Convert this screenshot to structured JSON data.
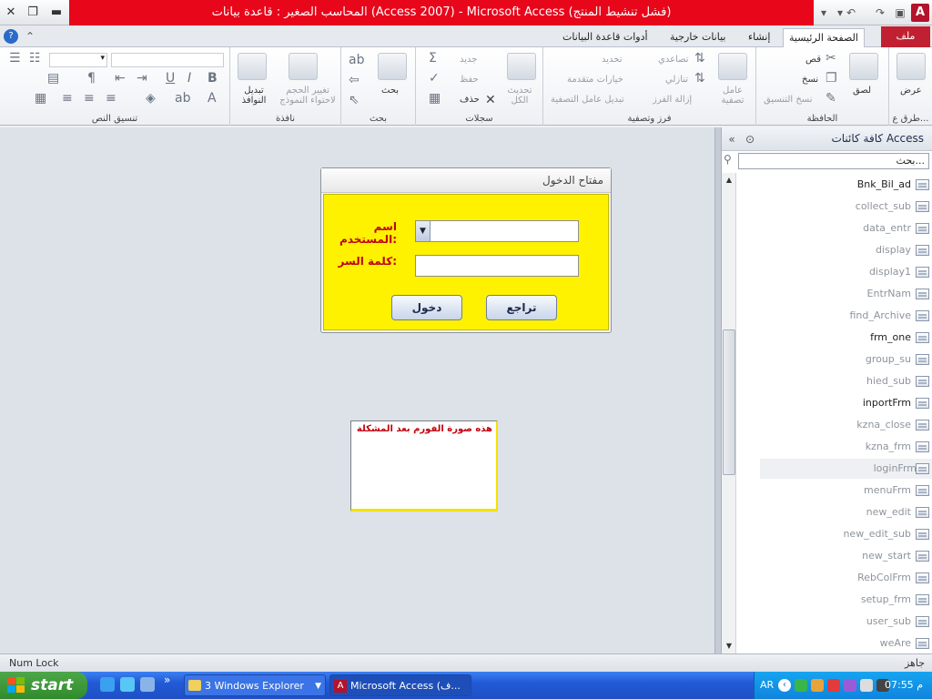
{
  "titlebar": {
    "title": "المحاسب الصغير : قاعدة بيانات (Access 2007) - Microsoft Access (فشل تنشيط المنتج)",
    "app_letter": "A"
  },
  "tabs": {
    "file": "ملف",
    "home": "الصفحة الرئيسية",
    "create": "إنشاء",
    "external": "بيانات خارجية",
    "dbtools": "أدوات قاعدة البيانات"
  },
  "ribbon": {
    "views": {
      "label": "طرق ع...",
      "view_btn": "عرض"
    },
    "clipboard": {
      "label": "الحافظة",
      "paste": "لصق",
      "cut": "قص",
      "copy": "نسخ",
      "format_painter": "نسخ التنسيق"
    },
    "sort_filter": {
      "label": "فرز وتصفية",
      "filter": "عامل\nتصفية",
      "ascending": "تصاعدي",
      "descending": "تنازلي",
      "remove_sort": "إزالة الفرز",
      "selection": "تحديد",
      "advanced": "خيارات متقدمة",
      "toggle_filter": "تبديل عامل التصفية"
    },
    "records": {
      "label": "سجلات",
      "refresh": "تحديث\nالكل",
      "new": "جديد",
      "save": "حفظ",
      "delete": "حذف"
    },
    "find": {
      "label": "بحث",
      "find": "بحث"
    },
    "window": {
      "label": "نافذة",
      "size_to_fit": "تغيير الحجم\nلاحتواء النموذج",
      "switch_windows": "تبديل\nالنوافذ"
    },
    "text_formatting": {
      "label": "تنسيق النص"
    }
  },
  "login_form": {
    "caption": "مفتاح الدخول",
    "username_label": "اسم المستخدم:",
    "password_label": "كلمة السر:",
    "login_button": "دخول",
    "cancel_button": "تراجع"
  },
  "note": {
    "text": "هذه صورة الفورم بعد المشكلة"
  },
  "navpane": {
    "title": "كافة كائنات Access",
    "search_placeholder": "بحث...",
    "items": [
      {
        "name": "Bnk_Bil_ad",
        "dim": false
      },
      {
        "name": "collect_sub",
        "dim": true
      },
      {
        "name": "data_entr",
        "dim": true
      },
      {
        "name": "display",
        "dim": true
      },
      {
        "name": "display1",
        "dim": true
      },
      {
        "name": "EntrNam",
        "dim": true
      },
      {
        "name": "find_Archive",
        "dim": true
      },
      {
        "name": "frm_one",
        "dim": false
      },
      {
        "name": "group_su",
        "dim": true
      },
      {
        "name": "hied_sub",
        "dim": true
      },
      {
        "name": "inportFrm",
        "dim": false
      },
      {
        "name": "kzna_close",
        "dim": true
      },
      {
        "name": "kzna_frm",
        "dim": true
      },
      {
        "name": "loginFrm",
        "dim": true,
        "highlight": true
      },
      {
        "name": "menuFrm",
        "dim": true
      },
      {
        "name": "new_edit",
        "dim": true
      },
      {
        "name": "new_edit_sub",
        "dim": true
      },
      {
        "name": "new_start",
        "dim": true
      },
      {
        "name": "RebColFrm",
        "dim": true
      },
      {
        "name": "setup_frm",
        "dim": true
      },
      {
        "name": "user_sub",
        "dim": true
      },
      {
        "name": "weAre",
        "dim": true
      }
    ]
  },
  "statusbar": {
    "left": "Num Lock",
    "right": "جاهز"
  },
  "taskbar": {
    "start": "start",
    "explorer": "3 Windows Explorer",
    "access": "Microsoft Access (ف...",
    "lang": "AR",
    "clock": "07:55 م"
  },
  "colors": {
    "title_red": "#e8061a",
    "file_tab": "#c02031",
    "form_yellow": "#fff200",
    "label_red": "#c0000d"
  }
}
